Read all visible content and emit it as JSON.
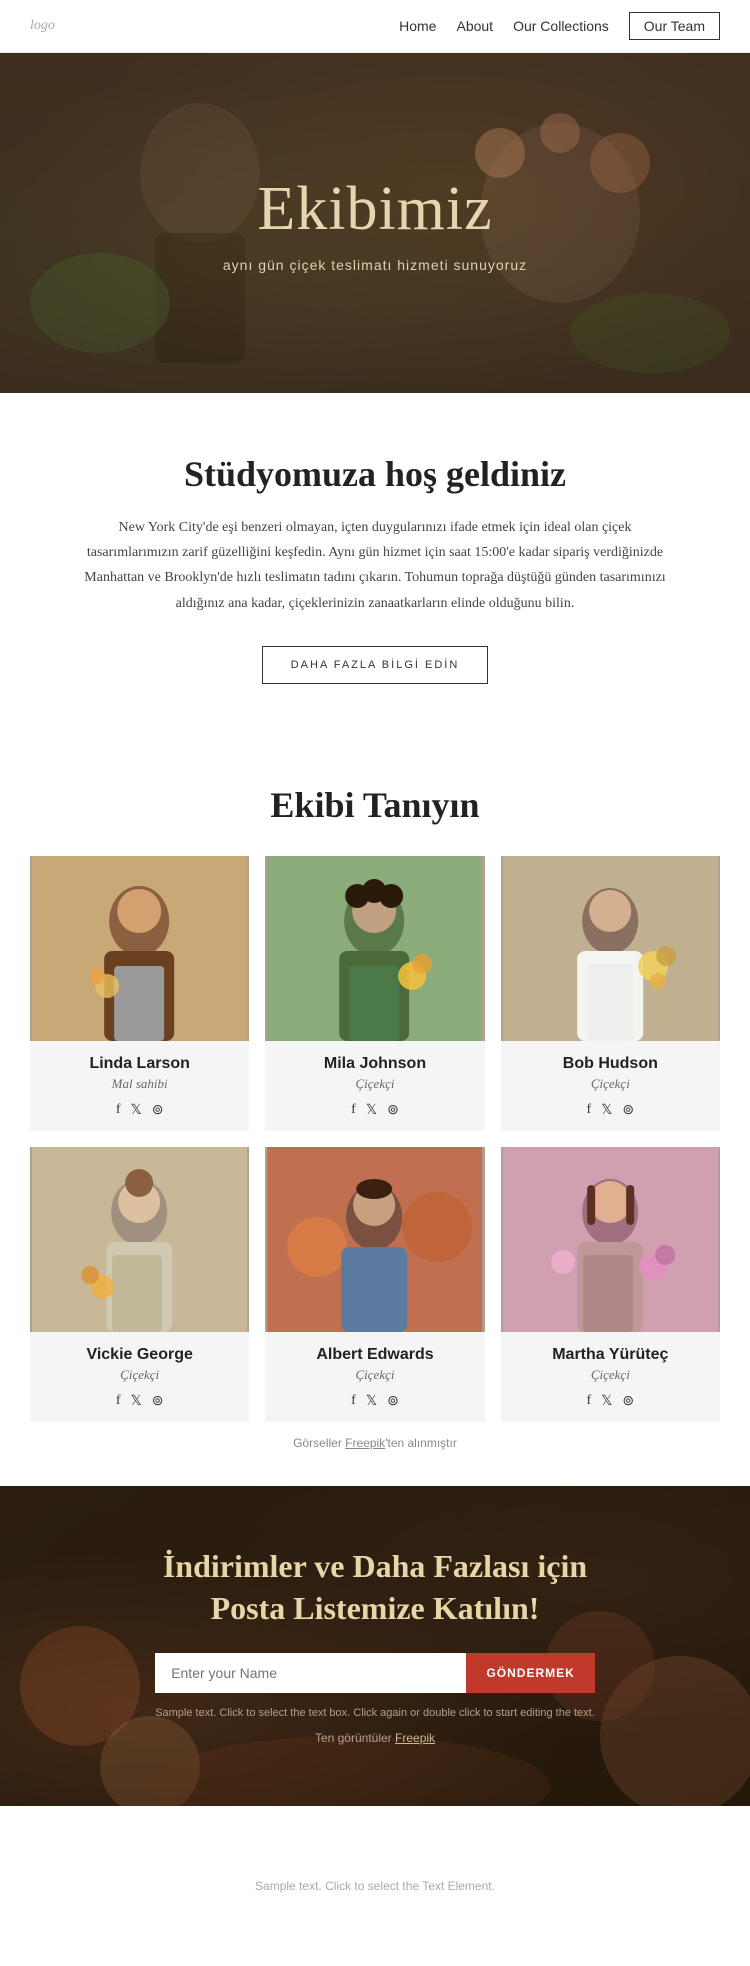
{
  "nav": {
    "logo": "logo",
    "links": [
      {
        "label": "Home",
        "active": false
      },
      {
        "label": "About",
        "active": false
      },
      {
        "label": "Our Collections",
        "active": false
      },
      {
        "label": "Our Team",
        "active": true,
        "outline": true
      }
    ]
  },
  "hero": {
    "title": "Ekibimiz",
    "subtitle": "aynı gün çiçek teslimatı hizmeti sunuyoruz"
  },
  "welcome": {
    "heading": "Stüdyomuza hoş geldiniz",
    "body": "New York City'de eşi benzeri olmayan, içten duygularınızı ifade etmek için ideal olan çiçek tasarımlarımızın zarif güzelliğini keşfedin. Aynı gün hizmet için saat 15:00'e kadar sipariş verdiğinizde Manhattan ve Brooklyn'de hızlı teslimatın tadını çıkarın. Tohumun toprağa düştüğü günden tasarımınızı aldığınız ana kadar, çiçeklerinizin zanaatkarların elinde olduğunu bilin.",
    "btn_label": "DAHA FAZLA BİLGİ EDİN"
  },
  "team": {
    "heading": "Ekibi Tanıyın",
    "members": [
      {
        "name": "Linda Larson",
        "role": "Mal sahibi",
        "img_class": "img-p1"
      },
      {
        "name": "Mila Johnson",
        "role": "Çiçekçi",
        "img_class": "img-p2"
      },
      {
        "name": "Bob Hudson",
        "role": "Çiçekçi",
        "img_class": "img-p3"
      },
      {
        "name": "Vickie George",
        "role": "Çiçekçi",
        "img_class": "img-p4"
      },
      {
        "name": "Albert Edwards",
        "role": "Çiçekçi",
        "img_class": "img-p5"
      },
      {
        "name": "Martha Yürüteç",
        "role": "Çiçekçi",
        "img_class": "img-p6"
      }
    ],
    "freepik_note": "Görseller ",
    "freepik_link": "Freepik",
    "freepik_suffix": "'ten alınmıştır"
  },
  "newsletter": {
    "heading": "İndirimler ve Daha Fazlası için\nPosta Listemize Katılın!",
    "input_placeholder": "Enter your Name",
    "btn_label": "GÖNDERMEK",
    "sample_text": "Sample text. Click to select the text box. Click again or double click to start editing the text.",
    "freepik_prefix": "Ten görüntüler ",
    "freepik_link": "Freepik"
  },
  "footer": {
    "sample_text": "Sample text. Click to select the Text Element."
  },
  "colors": {
    "accent_red": "#c0392b",
    "hero_title": "#e8d5b0",
    "newsletter_heading": "#e8d5a8"
  }
}
